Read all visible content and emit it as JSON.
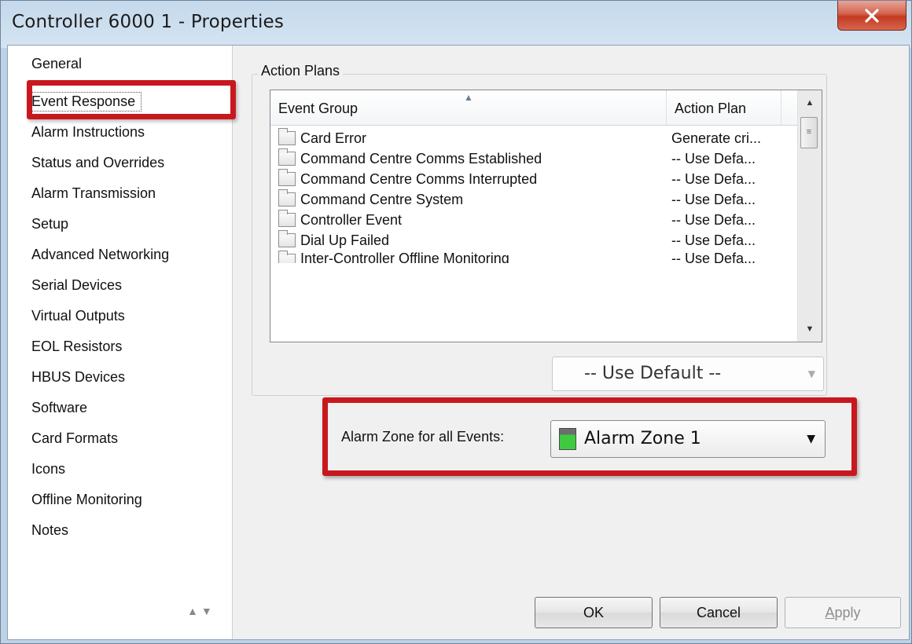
{
  "window": {
    "title": "Controller 6000 1 - Properties",
    "close_glyph": "X"
  },
  "nav": {
    "items": [
      {
        "label": "General"
      },
      {
        "label": "Event Response",
        "selected": true
      },
      {
        "label": "Alarm Instructions"
      },
      {
        "label": "Status and Overrides"
      },
      {
        "label": "Alarm Transmission"
      },
      {
        "label": "Setup"
      },
      {
        "label": "Advanced Networking"
      },
      {
        "label": "Serial Devices"
      },
      {
        "label": "Virtual Outputs"
      },
      {
        "label": "EOL Resistors"
      },
      {
        "label": "HBUS Devices"
      },
      {
        "label": "Software"
      },
      {
        "label": "Card Formats"
      },
      {
        "label": "Icons"
      },
      {
        "label": "Offline Monitoring"
      },
      {
        "label": "Notes"
      }
    ]
  },
  "action_plans": {
    "group_label": "Action Plans",
    "columns": [
      "Event Group",
      "Action Plan"
    ],
    "rows": [
      {
        "name": "Card Error",
        "plan": "Generate cri..."
      },
      {
        "name": "Command Centre Comms Established",
        "plan": "-- Use Defa..."
      },
      {
        "name": "Command Centre Comms Interrupted",
        "plan": "-- Use Defa..."
      },
      {
        "name": "Command Centre System",
        "plan": "-- Use Defa..."
      },
      {
        "name": "Controller Event",
        "plan": "-- Use Defa..."
      },
      {
        "name": "Dial Up Failed",
        "plan": "-- Use Defa..."
      },
      {
        "name": "Inter-Controller Offline Monitoring",
        "plan": "-- Use Defa..."
      }
    ],
    "plan_combo": "-- Use Default --"
  },
  "alarm_zone": {
    "label": "Alarm Zone for all Events:",
    "value": "Alarm Zone 1",
    "icon": "alarm-zone-icon",
    "icon_color": "#3fcb3f"
  },
  "buttons": {
    "ok": "OK",
    "cancel": "Cancel",
    "apply_accel": "A",
    "apply_rest": "pply"
  },
  "colors": {
    "highlight": "#c8181e",
    "close_button": "#c33a22"
  }
}
